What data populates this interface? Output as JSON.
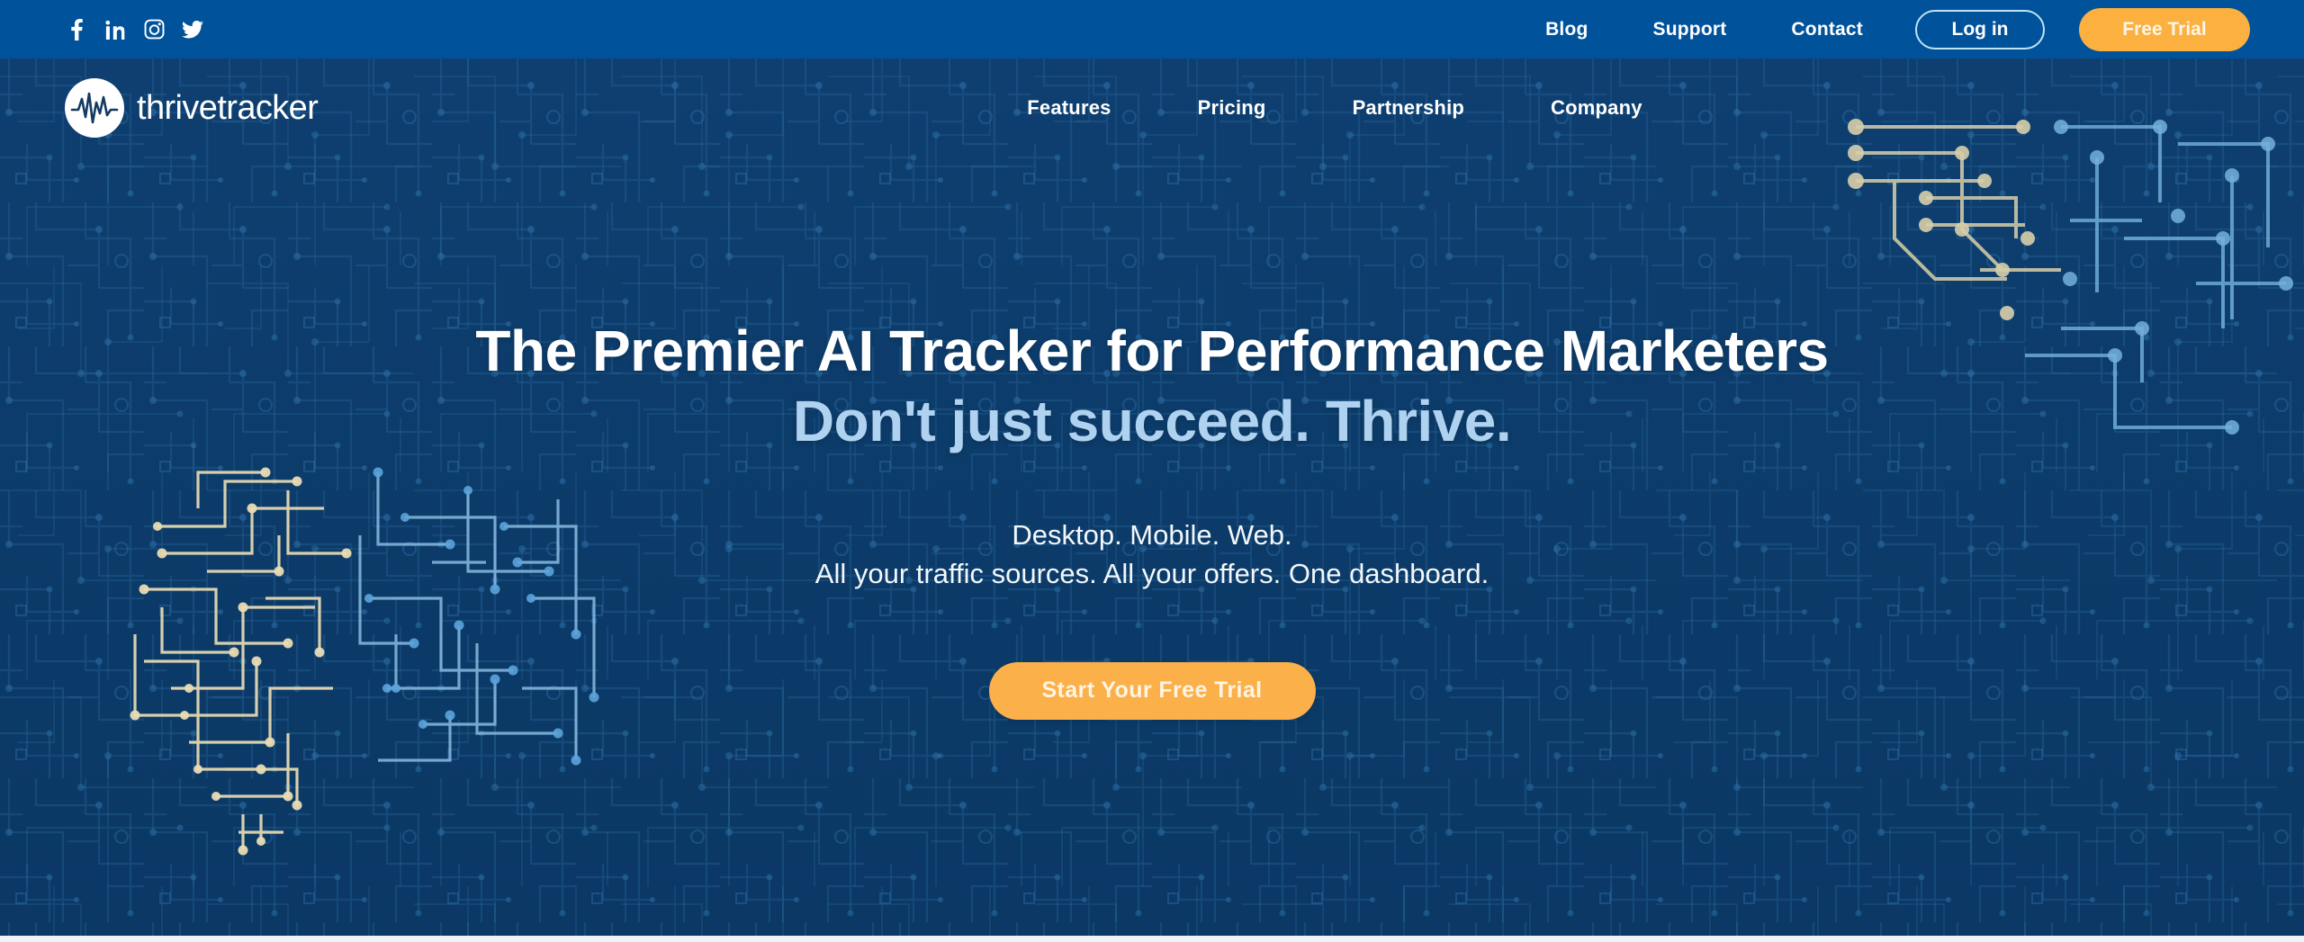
{
  "colors": {
    "topbar_bg": "#00529b",
    "hero_bg": "#0d3c6b",
    "accent_orange": "#fbb040",
    "accent_light_blue": "#aed2ef",
    "text_white": "#ffffff",
    "login_border": "#bfe4f5",
    "trace_tan": "#e9dcb4",
    "trace_blue": "#3f8ecb"
  },
  "topbar": {
    "social": [
      {
        "name": "facebook-icon",
        "label": "Facebook"
      },
      {
        "name": "linkedin-icon",
        "label": "LinkedIn"
      },
      {
        "name": "instagram-icon",
        "label": "Instagram"
      },
      {
        "name": "twitter-icon",
        "label": "Twitter"
      }
    ],
    "links": [
      {
        "label": "Blog"
      },
      {
        "label": "Support"
      },
      {
        "label": "Contact"
      }
    ],
    "login_label": "Log in",
    "free_trial_label": "Free Trial"
  },
  "masthead": {
    "logo_text": "thrivetracker",
    "logo_mark": "pulse-waveform-icon",
    "nav": [
      {
        "label": "Features"
      },
      {
        "label": "Pricing"
      },
      {
        "label": "Partnership"
      },
      {
        "label": "Company"
      }
    ]
  },
  "hero": {
    "headline": "The Premier AI Tracker for Performance Marketers",
    "subheadline": "Don't just succeed. Thrive.",
    "lede_line1": "Desktop. Mobile. Web.",
    "lede_line2": "All your traffic sources. All your offers. One dashboard.",
    "cta_label": "Start Your Free Trial",
    "graphic": "circuit-brain-illustration",
    "background": "circuit-board-pattern"
  }
}
